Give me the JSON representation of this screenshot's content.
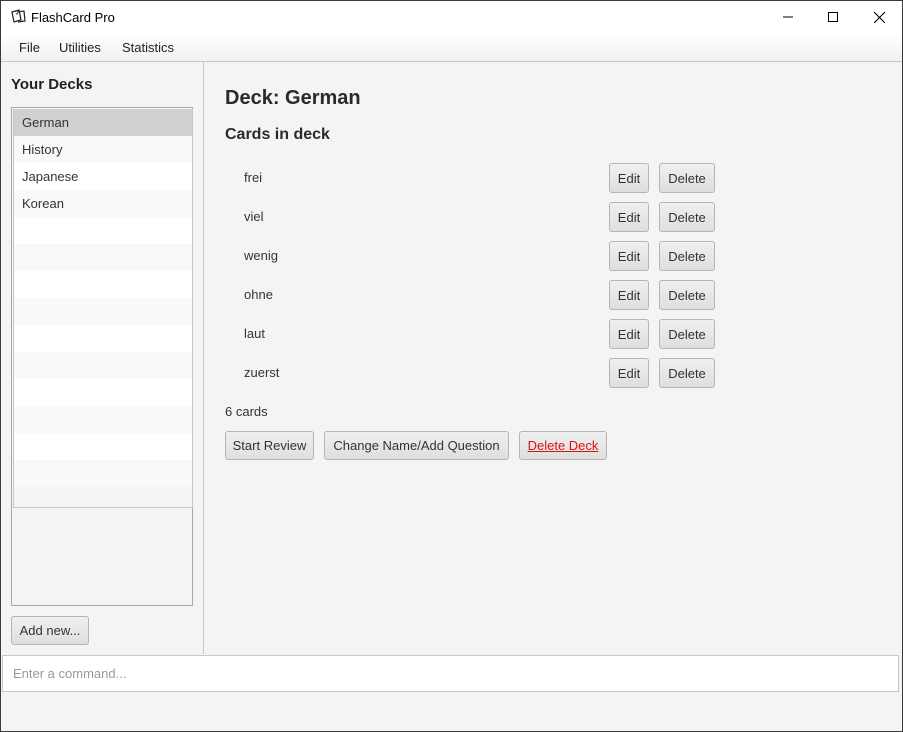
{
  "window": {
    "title": "FlashCard Pro"
  },
  "menu": {
    "items": [
      "File",
      "Utilities",
      "Statistics"
    ]
  },
  "sidebar": {
    "title": "Your Decks",
    "decks": [
      "German",
      "History",
      "Japanese",
      "Korean"
    ],
    "selected": "German",
    "add_label": "Add new..."
  },
  "deck": {
    "title": "Deck: German",
    "cards_heading": "Cards in deck",
    "cards": [
      {
        "name": "frei",
        "edit_label": "Edit",
        "delete_label": "Delete"
      },
      {
        "name": "viel",
        "edit_label": "Edit",
        "delete_label": "Delete"
      },
      {
        "name": "wenig",
        "edit_label": "Edit",
        "delete_label": "Delete"
      },
      {
        "name": "ohne",
        "edit_label": "Edit",
        "delete_label": "Delete"
      },
      {
        "name": "laut",
        "edit_label": "Edit",
        "delete_label": "Delete"
      },
      {
        "name": "zuerst",
        "edit_label": "Edit",
        "delete_label": "Delete"
      }
    ],
    "count_text": "6 cards",
    "actions": {
      "start_review": "Start Review",
      "change_name": "Change Name/Add Question",
      "delete_deck": "Delete Deck"
    }
  },
  "command": {
    "placeholder": "Enter a command...",
    "value": ""
  },
  "colors": {
    "danger": "#d11111",
    "selected_row": "#d0d0d0",
    "pane_bg": "#f4f4f4"
  },
  "icons": {
    "app": "cards-icon",
    "minimize": "minimize-icon",
    "maximize": "maximize-icon",
    "close": "close-icon"
  }
}
